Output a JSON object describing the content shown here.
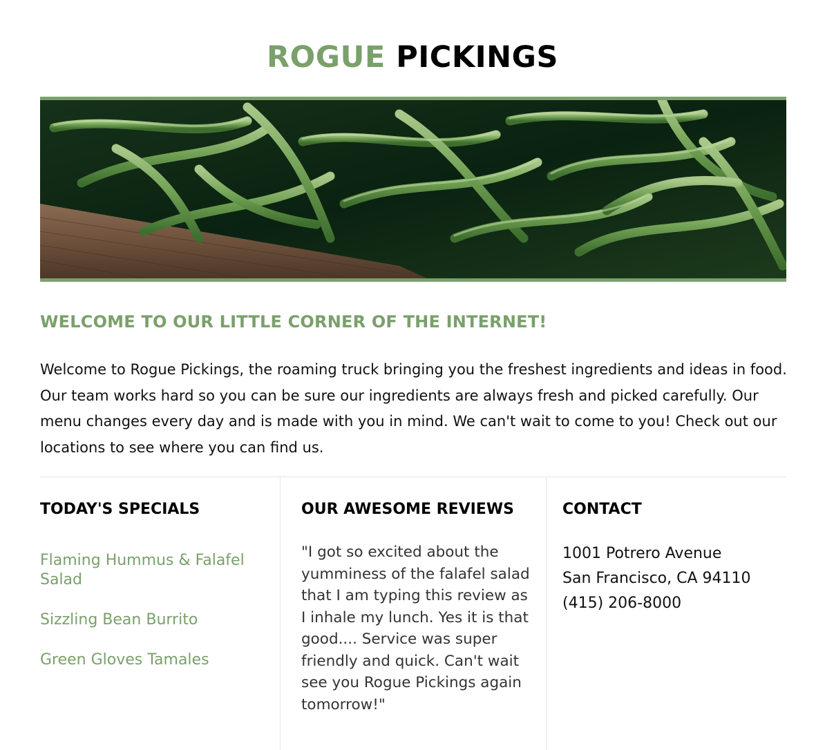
{
  "site": {
    "title_accent": "ROGUE",
    "title_rest": "PICKINGS",
    "accent_color": "#7aa06b"
  },
  "hero": {
    "image_icon": "green-beans-photo"
  },
  "welcome": {
    "heading": "WELCOME TO OUR LITTLE CORNER OF THE INTERNET!",
    "text": "Welcome to Rogue Pickings, the roaming truck bringing you the freshest ingredients and ideas in food. Our team works hard so you can be sure our ingredients are always fresh and picked carefully. Our menu changes every day and is made with you in mind. We can't wait to come to you! Check out our locations to see where you can find us."
  },
  "specials": {
    "heading": "TODAY'S SPECIALS",
    "items": [
      "Flaming Hummus & Falafel Salad",
      "Sizzling Bean Burrito",
      "Green Gloves Tamales"
    ]
  },
  "reviews": {
    "heading": "OUR AWESOME REVIEWS",
    "quote": "\"I got so excited about the yumminess of the falafel salad that I am typing this review as I inhale my lunch. Yes it is that good.... Service was super friendly and quick. Can't wait see you Rogue Pickings again tomorrow!\""
  },
  "contact": {
    "heading": "CONTACT",
    "street": "1001 Potrero Avenue",
    "city": "San Francisco, CA 94110",
    "phone": "(415) 206-8000"
  }
}
